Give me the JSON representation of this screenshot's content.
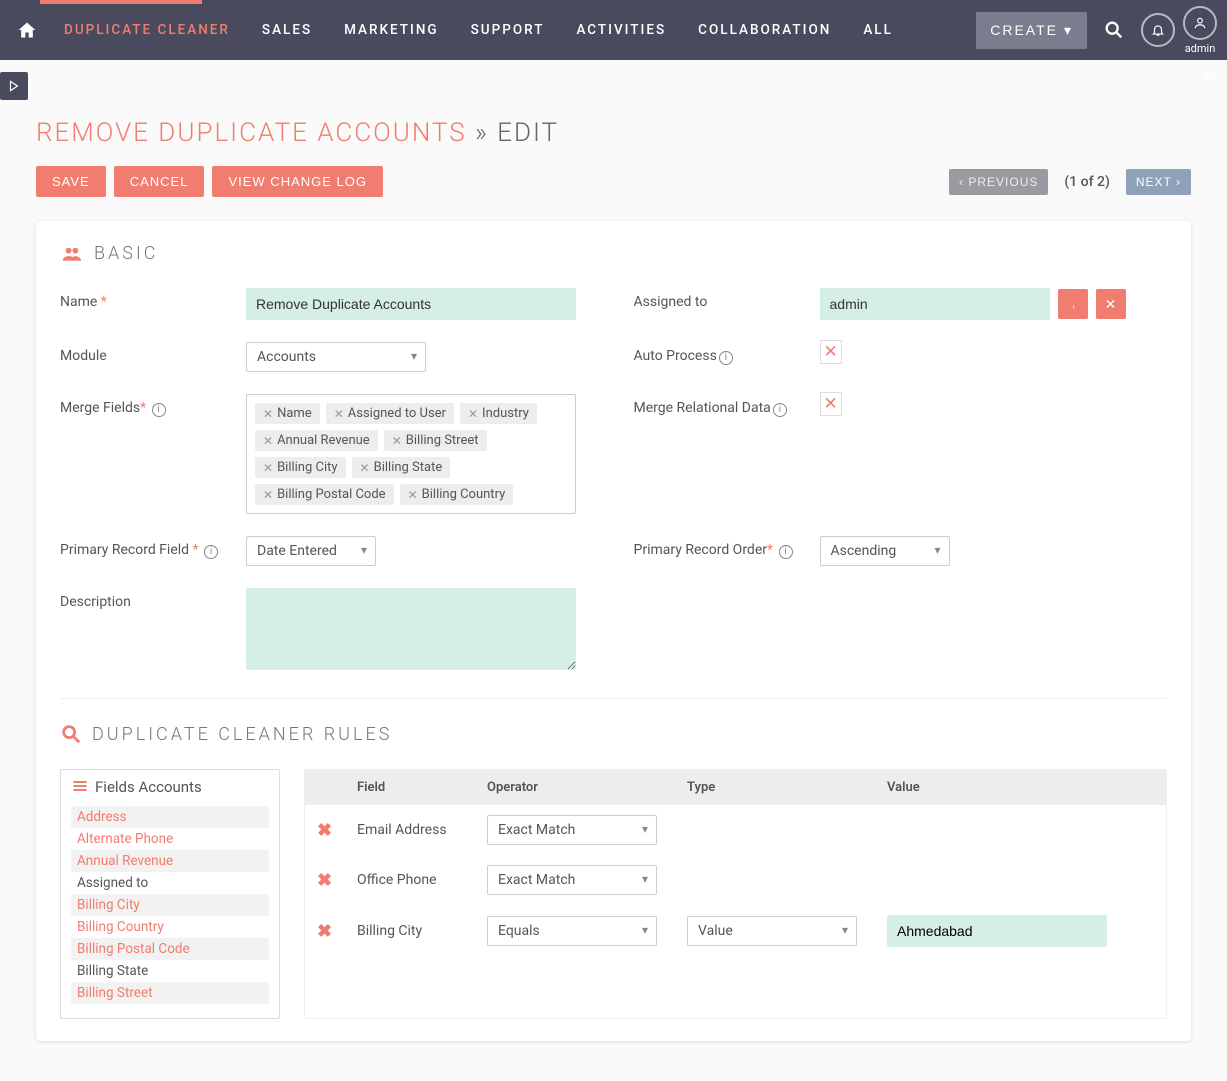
{
  "nav": {
    "items": [
      "DUPLICATE CLEANER",
      "SALES",
      "MARKETING",
      "SUPPORT",
      "ACTIVITIES",
      "COLLABORATION",
      "ALL"
    ],
    "create": "CREATE",
    "user": "admin"
  },
  "page": {
    "title_main": "REMOVE DUPLICATE ACCOUNTS",
    "title_sep": "»",
    "title_sub": "EDIT",
    "save": "SAVE",
    "cancel": "CANCEL",
    "changelog": "VIEW CHANGE LOG",
    "previous": "PREVIOUS",
    "pager": "(1 of 2)",
    "next": "NEXT"
  },
  "basic": {
    "heading": "BASIC",
    "labels": {
      "name": "Name",
      "assigned_to": "Assigned to",
      "module": "Module",
      "auto_process": "Auto Process",
      "merge_fields": "Merge Fields",
      "merge_relational": "Merge Relational Data",
      "primary_field": "Primary Record Field",
      "primary_order": "Primary Record Order",
      "description": "Description"
    },
    "values": {
      "name": "Remove Duplicate Accounts",
      "assigned_to": "admin",
      "module": "Accounts",
      "primary_field": "Date Entered",
      "primary_order": "Ascending",
      "description": ""
    },
    "merge_tags": [
      "Name",
      "Assigned to User",
      "Industry",
      "Annual Revenue",
      "Billing Street",
      "Billing City",
      "Billing State",
      "Billing Postal Code",
      "Billing Country"
    ]
  },
  "rules": {
    "heading": "DUPLICATE CLEANER RULES",
    "fields_panel_title": "Fields Accounts",
    "available_fields": [
      {
        "label": "Address",
        "hl": true
      },
      {
        "label": "Alternate Phone",
        "hl": true
      },
      {
        "label": "Annual Revenue",
        "hl": true
      },
      {
        "label": "Assigned to",
        "hl": false
      },
      {
        "label": "Billing City",
        "hl": true
      },
      {
        "label": "Billing Country",
        "hl": true
      },
      {
        "label": "Billing Postal Code",
        "hl": true
      },
      {
        "label": "Billing State",
        "hl": false
      },
      {
        "label": "Billing Street",
        "hl": true
      }
    ],
    "cols": {
      "field": "Field",
      "operator": "Operator",
      "type": "Type",
      "value": "Value"
    },
    "rows": [
      {
        "field": "Email Address",
        "operator": "Exact Match",
        "type": "",
        "value": ""
      },
      {
        "field": "Office Phone",
        "operator": "Exact Match",
        "type": "",
        "value": ""
      },
      {
        "field": "Billing City",
        "operator": "Equals",
        "type": "Value",
        "value": "Ahmedabad"
      }
    ]
  }
}
